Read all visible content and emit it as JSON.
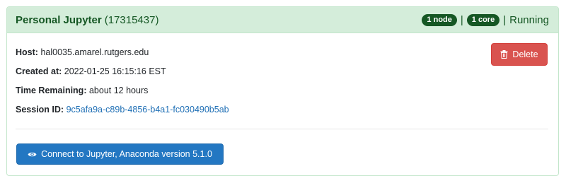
{
  "header": {
    "title": "Personal Jupyter",
    "session_number": "(17315437)",
    "nodes_badge": "1 node",
    "separator": "|",
    "cores_badge": "1 core",
    "status": "Running"
  },
  "details": {
    "host_label": "Host:",
    "host_value": "hal0035.amarel.rutgers.edu",
    "created_label": "Created at:",
    "created_value": "2022-01-25 16:15:16 EST",
    "time_label": "Time Remaining:",
    "time_value": "about 12 hours",
    "session_label": "Session ID:",
    "session_value": "9c5afa9a-c89b-4856-b4a1-fc030490b5ab"
  },
  "actions": {
    "delete_label": "Delete",
    "connect_label": "Connect to Jupyter, Anaconda version 5.1.0"
  },
  "icons": {
    "delete": "trash-icon",
    "connect": "eye-icon"
  },
  "colors": {
    "header_bg": "#d4edda",
    "header_text": "#155724",
    "delete_button": "#d9534f",
    "connect_button": "#2377c2",
    "link": "#1f6fb5"
  }
}
